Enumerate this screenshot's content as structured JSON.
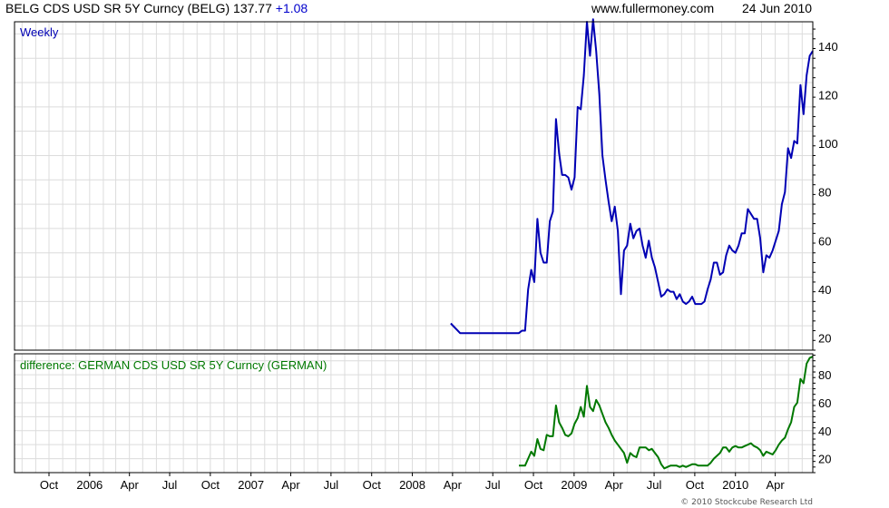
{
  "header": {
    "title": "BELG CDS USD SR 5Y Curncy (BELG)",
    "last_value": "137.77",
    "change": "+1.08",
    "website": "www.fullermoney.com",
    "date": "24 Jun 2010"
  },
  "footer": {
    "copyright": "© 2010 Stockcube Research Ltd"
  },
  "colors": {
    "main_series": "#0000b4",
    "sub_series": "#007800",
    "change": "#0000cc",
    "grid": "#dcdcdc",
    "frame": "#000000"
  },
  "chart_data": [
    {
      "type": "line",
      "panel": "main",
      "label": "Weekly",
      "ylim": [
        15,
        150
      ],
      "yticks": [
        20,
        40,
        60,
        80,
        100,
        120,
        140
      ],
      "xlim": [
        "2005-07-15",
        "2010-06-25"
      ],
      "x_tick_labels": [
        "Oct",
        "2006",
        "Apr",
        "Jul",
        "Oct",
        "2007",
        "Apr",
        "Jul",
        "Oct",
        "2008",
        "Apr",
        "Jul",
        "Oct",
        "2009",
        "Apr",
        "Jul",
        "Oct",
        "2010",
        "Apr"
      ],
      "x_ticks": [
        "2005-10-01",
        "2006-01-01",
        "2006-04-01",
        "2006-07-01",
        "2006-10-01",
        "2007-01-01",
        "2007-04-01",
        "2007-07-01",
        "2007-10-01",
        "2008-01-01",
        "2008-04-01",
        "2008-07-01",
        "2008-10-01",
        "2009-01-01",
        "2009-04-01",
        "2009-07-01",
        "2009-10-01",
        "2010-01-01",
        "2010-04-01"
      ],
      "series": [
        {
          "x": [
            "2008-03-28",
            "2008-04-18",
            "2008-05-01",
            "2008-06-01",
            "2008-07-01",
            "2008-08-01",
            "2008-08-29",
            "2008-09-05",
            "2008-09-12",
            "2008-09-19",
            "2008-09-26",
            "2008-10-03",
            "2008-10-10",
            "2008-10-17",
            "2008-10-24",
            "2008-10-31",
            "2008-11-07",
            "2008-11-14",
            "2008-11-21",
            "2008-11-28",
            "2008-12-05",
            "2008-12-12",
            "2008-12-19",
            "2008-12-26",
            "2009-01-02",
            "2009-01-09",
            "2009-01-16",
            "2009-01-23",
            "2009-01-30",
            "2009-02-06",
            "2009-02-13",
            "2009-02-20",
            "2009-02-27",
            "2009-03-06",
            "2009-03-13",
            "2009-03-20",
            "2009-03-27",
            "2009-04-03",
            "2009-04-10",
            "2009-04-17",
            "2009-04-24",
            "2009-05-01",
            "2009-05-08",
            "2009-05-15",
            "2009-05-22",
            "2009-05-29",
            "2009-06-05",
            "2009-06-12",
            "2009-06-19",
            "2009-06-26",
            "2009-07-03",
            "2009-07-10",
            "2009-07-17",
            "2009-07-24",
            "2009-07-31",
            "2009-08-07",
            "2009-08-14",
            "2009-08-21",
            "2009-08-28",
            "2009-09-04",
            "2009-09-11",
            "2009-09-18",
            "2009-09-25",
            "2009-10-02",
            "2009-10-09",
            "2009-10-16",
            "2009-10-23",
            "2009-10-30",
            "2009-11-06",
            "2009-11-13",
            "2009-11-20",
            "2009-11-27",
            "2009-12-04",
            "2009-12-11",
            "2009-12-18",
            "2009-12-25",
            "2010-01-01",
            "2010-01-08",
            "2010-01-15",
            "2010-01-22",
            "2010-01-29",
            "2010-02-05",
            "2010-02-12",
            "2010-02-19",
            "2010-02-26",
            "2010-03-05",
            "2010-03-12",
            "2010-03-19",
            "2010-03-26",
            "2010-04-02",
            "2010-04-09",
            "2010-04-16",
            "2010-04-23",
            "2010-04-30",
            "2010-05-07",
            "2010-05-14",
            "2010-05-21",
            "2010-05-28",
            "2010-06-04",
            "2010-06-11",
            "2010-06-18",
            "2010-06-25"
          ],
          "values": [
            26,
            22,
            22,
            22,
            22,
            22,
            22,
            23,
            23,
            40,
            48,
            43,
            69,
            55,
            51,
            51,
            68,
            72,
            110,
            96,
            87,
            87,
            86,
            81,
            86,
            115,
            114,
            128,
            150,
            136,
            151,
            138,
            120,
            95,
            85,
            76,
            68,
            74,
            64,
            38,
            56,
            58,
            67,
            61,
            64,
            65,
            58,
            53,
            60,
            53,
            49,
            43,
            37,
            38,
            40,
            39,
            39,
            36,
            38,
            35,
            34,
            35,
            37,
            34,
            34,
            34,
            35,
            40,
            44,
            51,
            51,
            46,
            47,
            54,
            58,
            56,
            55,
            58,
            63,
            63,
            73,
            71,
            69,
            69,
            61,
            47,
            54,
            53,
            56,
            60,
            64,
            75,
            80,
            98,
            94,
            101,
            100,
            124,
            112,
            128,
            136,
            138
          ]
        }
      ]
    },
    {
      "type": "line",
      "panel": "sub",
      "label": "difference: GERMAN CDS USD SR 5Y Curncy (GERMAN)",
      "ylim": [
        10,
        95
      ],
      "yticks": [
        20,
        40,
        60,
        80
      ],
      "series": [
        {
          "x": [
            "2008-08-29",
            "2008-09-05",
            "2008-09-12",
            "2008-09-19",
            "2008-09-26",
            "2008-10-03",
            "2008-10-10",
            "2008-10-17",
            "2008-10-24",
            "2008-10-31",
            "2008-11-07",
            "2008-11-14",
            "2008-11-21",
            "2008-11-28",
            "2008-12-05",
            "2008-12-12",
            "2008-12-19",
            "2008-12-26",
            "2009-01-02",
            "2009-01-09",
            "2009-01-16",
            "2009-01-23",
            "2009-01-30",
            "2009-02-06",
            "2009-02-13",
            "2009-02-20",
            "2009-02-27",
            "2009-03-06",
            "2009-03-13",
            "2009-03-20",
            "2009-03-27",
            "2009-04-03",
            "2009-04-10",
            "2009-04-17",
            "2009-04-24",
            "2009-05-01",
            "2009-05-08",
            "2009-05-15",
            "2009-05-22",
            "2009-05-29",
            "2009-06-05",
            "2009-06-12",
            "2009-06-19",
            "2009-06-26",
            "2009-07-03",
            "2009-07-10",
            "2009-07-17",
            "2009-07-24",
            "2009-07-31",
            "2009-08-07",
            "2009-08-14",
            "2009-08-21",
            "2009-08-28",
            "2009-09-04",
            "2009-09-11",
            "2009-09-18",
            "2009-09-25",
            "2009-10-02",
            "2009-10-09",
            "2009-10-16",
            "2009-10-23",
            "2009-10-30",
            "2009-11-06",
            "2009-11-13",
            "2009-11-20",
            "2009-11-27",
            "2009-12-04",
            "2009-12-11",
            "2009-12-18",
            "2009-12-25",
            "2010-01-01",
            "2010-01-08",
            "2010-01-15",
            "2010-01-22",
            "2010-01-29",
            "2010-02-05",
            "2010-02-12",
            "2010-02-19",
            "2010-02-26",
            "2010-03-05",
            "2010-03-12",
            "2010-03-19",
            "2010-03-26",
            "2010-04-02",
            "2010-04-09",
            "2010-04-16",
            "2010-04-23",
            "2010-04-30",
            "2010-05-07",
            "2010-05-14",
            "2010-05-21",
            "2010-05-28",
            "2010-06-04",
            "2010-06-11",
            "2010-06-18",
            "2010-06-25"
          ],
          "values": [
            15,
            15,
            15,
            20,
            25,
            22,
            34,
            27,
            26,
            37,
            36,
            36,
            58,
            46,
            42,
            37,
            36,
            38,
            45,
            49,
            57,
            50,
            72,
            57,
            54,
            62,
            58,
            52,
            46,
            42,
            37,
            33,
            30,
            27,
            24,
            17,
            24,
            22,
            21,
            28,
            28,
            28,
            26,
            27,
            24,
            21,
            16,
            13,
            14,
            15,
            15,
            15,
            14,
            15,
            14,
            15,
            16,
            16,
            15,
            15,
            15,
            15,
            17,
            20,
            22,
            24,
            28,
            28,
            25,
            28,
            29,
            28,
            28,
            29,
            30,
            31,
            29,
            28,
            26,
            22,
            25,
            24,
            23,
            26,
            30,
            33,
            35,
            41,
            46,
            57,
            60,
            77,
            74,
            88,
            92,
            93
          ]
        }
      ]
    }
  ]
}
